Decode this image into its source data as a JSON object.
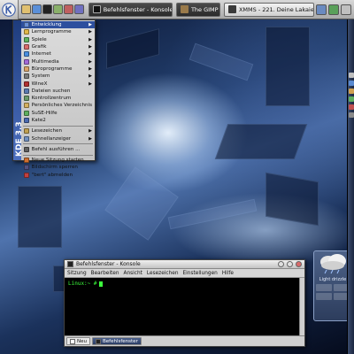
{
  "taskbar": {
    "tasks": [
      {
        "label": "Befehlsfenster - Konsole",
        "style": "dark"
      },
      {
        "label": "The GIMP",
        "style": "dark"
      },
      {
        "label": "XMMS - 221. Deine Lakaien - Pri",
        "style": "light"
      }
    ]
  },
  "kmenu": {
    "side_label": "KDE 3.3",
    "items": [
      {
        "label": "Entwicklung",
        "submenu": true,
        "active": true,
        "icon_color": "#6a8fd6"
      },
      {
        "label": "Lernprogramme",
        "submenu": true,
        "icon_color": "#e0b84a"
      },
      {
        "label": "Spiele",
        "submenu": true,
        "icon_color": "#5fb35f"
      },
      {
        "label": "Grafik",
        "submenu": true,
        "icon_color": "#d96b6b"
      },
      {
        "label": "Internet",
        "submenu": true,
        "icon_color": "#4a8fe0"
      },
      {
        "label": "Multimedia",
        "submenu": true,
        "icon_color": "#a36ad9"
      },
      {
        "label": "Büroprogramme",
        "submenu": true,
        "icon_color": "#d9a36a"
      },
      {
        "label": "System",
        "submenu": true,
        "icon_color": "#7a7a7a"
      },
      {
        "label": "WineX",
        "submenu": true,
        "icon_color": "#b03030"
      },
      {
        "label": "Dateien suchen",
        "submenu": false,
        "icon_color": "#5a7ab0"
      },
      {
        "label": "Kontrollzentrum",
        "submenu": false,
        "icon_color": "#6a9a6a"
      },
      {
        "label": "Persönliches Verzeichnis",
        "submenu": false,
        "icon_color": "#d4b060"
      },
      {
        "label": "SuSE-Hilfe",
        "submenu": false,
        "icon_color": "#5faf5f"
      },
      {
        "label": "Kate2",
        "submenu": false,
        "icon_color": "#4a6ab0"
      },
      {
        "label": "Lesezeichen",
        "submenu": true,
        "icon_color": "#c0a050",
        "sep_before": true
      },
      {
        "label": "Schnellanzeiger",
        "submenu": true,
        "icon_color": "#7090c0"
      },
      {
        "label": "Befehl ausführen ...",
        "submenu": false,
        "icon_color": "#606060",
        "sep_before": true
      },
      {
        "label": "Neue Sitzung starten",
        "submenu": false,
        "icon_color": "#d07030",
        "sep_before": true
      },
      {
        "label": "Bildschirm sperren",
        "submenu": false,
        "icon_color": "#505080"
      },
      {
        "label": "\"bert\" abmelden",
        "submenu": false,
        "icon_color": "#c04040"
      }
    ]
  },
  "konsole": {
    "title": "Befehlsfenster - Konsole",
    "menu": [
      "Sitzung",
      "Bearbeiten",
      "Ansicht",
      "Lesezeichen",
      "Einstellungen",
      "Hilfe"
    ],
    "prompt": "Linux:~ #",
    "tabs": {
      "new_label": "Neu",
      "current_label": "Befehlsfenster"
    }
  },
  "weather": {
    "description": "Light drizzle"
  },
  "colors": {
    "menu_highlight": "#2d4f9e",
    "terminal_text": "#3cff3c",
    "panel_gray": "#c3c3c3"
  }
}
